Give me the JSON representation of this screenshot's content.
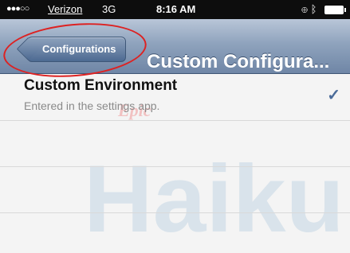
{
  "status_bar": {
    "signal": "●●●○○",
    "carrier": "Verizon",
    "network": "3G",
    "time": "8:16 AM"
  },
  "nav": {
    "back_label": "Configurations",
    "title": "Custom Configura..."
  },
  "rows": [
    {
      "title": "Custom Environment",
      "subtitle": "Entered in the settings app.",
      "checked": true
    }
  ],
  "watermark": {
    "top_text": "Epic",
    "main_text": "Haiku",
    "color": "#a9c6dc"
  },
  "colors": {
    "navbar": "#7f94b2",
    "check": "#4a6b99",
    "annotation": "#dd2222"
  },
  "icons": [
    "check-icon",
    "battery-icon",
    "location-icon",
    "bluetooth-icon"
  ]
}
